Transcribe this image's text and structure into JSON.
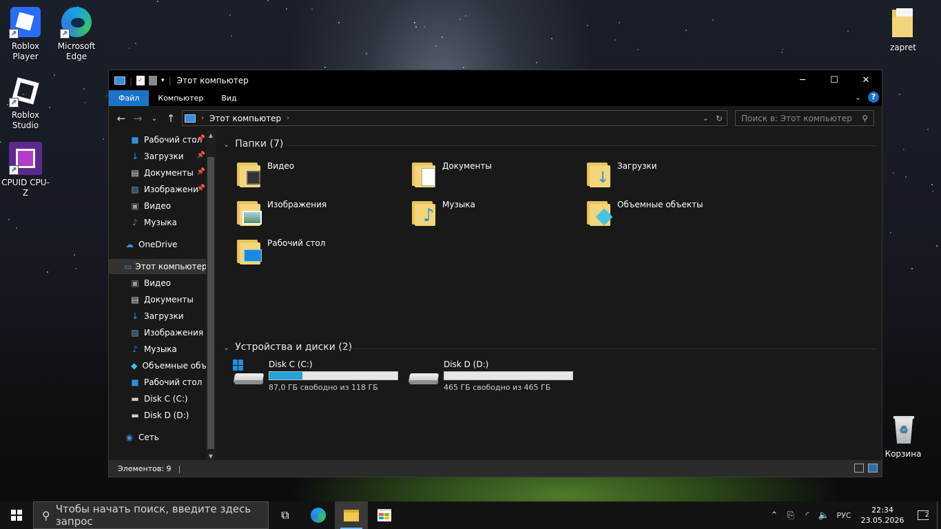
{
  "desktop": {
    "icons": [
      {
        "label": "Roblox Player",
        "icon": "roblox-player-icon"
      },
      {
        "label": "Microsoft Edge",
        "icon": "edge-icon"
      },
      {
        "label": "Roblox Studio",
        "icon": "roblox-studio-icon"
      },
      {
        "label": "CPUID CPU-Z",
        "icon": "cpuz-icon"
      },
      {
        "label": "zapret",
        "icon": "folder-zip-icon"
      },
      {
        "label": "Корзина",
        "icon": "recycle-bin-icon"
      }
    ]
  },
  "window": {
    "title": "Этот компьютер",
    "ribbon": {
      "file": "Файл",
      "computer": "Компьютер",
      "view": "Вид"
    },
    "address": {
      "path": "Этот компьютер"
    },
    "search": {
      "placeholder": "Поиск в: Этот компьютер"
    },
    "sidebar": {
      "items": [
        {
          "label": "Рабочий стол",
          "icon": "desktop-icon",
          "pinned": true
        },
        {
          "label": "Загрузки",
          "icon": "downloads-icon",
          "pinned": true
        },
        {
          "label": "Документы",
          "icon": "documents-icon",
          "pinned": true
        },
        {
          "label": "Изображени",
          "icon": "pictures-icon",
          "pinned": true
        },
        {
          "label": "Видео",
          "icon": "video-icon"
        },
        {
          "label": "Музыка",
          "icon": "music-icon"
        },
        {
          "label": "OneDrive",
          "icon": "onedrive-icon"
        },
        {
          "label": "Этот компьютер",
          "icon": "this-pc-icon",
          "selected": true
        },
        {
          "label": "Видео",
          "icon": "video-icon"
        },
        {
          "label": "Документы",
          "icon": "documents-icon"
        },
        {
          "label": "Загрузки",
          "icon": "downloads-icon"
        },
        {
          "label": "Изображения",
          "icon": "pictures-icon"
        },
        {
          "label": "Музыка",
          "icon": "music-icon"
        },
        {
          "label": "Объемные объ",
          "icon": "3d-objects-icon"
        },
        {
          "label": "Рабочий стол",
          "icon": "desktop-icon"
        },
        {
          "label": "Disk  C (C:)",
          "icon": "drive-c-icon"
        },
        {
          "label": "Disk D (D:)",
          "icon": "drive-d-icon"
        },
        {
          "label": "Сеть",
          "icon": "network-icon"
        }
      ]
    },
    "folders_header": "Папки (7)",
    "folders": [
      {
        "label": "Видео",
        "overlay": "video"
      },
      {
        "label": "Документы",
        "overlay": "documents"
      },
      {
        "label": "Загрузки",
        "overlay": "downloads"
      },
      {
        "label": "Изображения",
        "overlay": "pictures"
      },
      {
        "label": "Музыка",
        "overlay": "music"
      },
      {
        "label": "Объемные объекты",
        "overlay": "3d"
      },
      {
        "label": "Рабочий стол",
        "overlay": "desktop"
      }
    ],
    "drives_header": "Устройства и диски (2)",
    "drives": [
      {
        "name": "Disk  C (C:)",
        "free": "87,0 ГБ свободно из 118 ГБ",
        "used_fraction": 0.26,
        "system": true
      },
      {
        "name": "Disk D (D:)",
        "free": "465 ГБ свободно из 465 ГБ",
        "used_fraction": 0.0,
        "system": false
      }
    ],
    "status": "Элементов: 9"
  },
  "taskbar": {
    "search_placeholder": "Чтобы начать поиск, введите здесь запрос",
    "language": "РУС",
    "time": "22:34",
    "date": "23.05.2026",
    "notifications": "2"
  },
  "colors": {
    "accent": "#1a73c9",
    "drive_bar": "#26a0da",
    "folder": "#f4d57a"
  }
}
